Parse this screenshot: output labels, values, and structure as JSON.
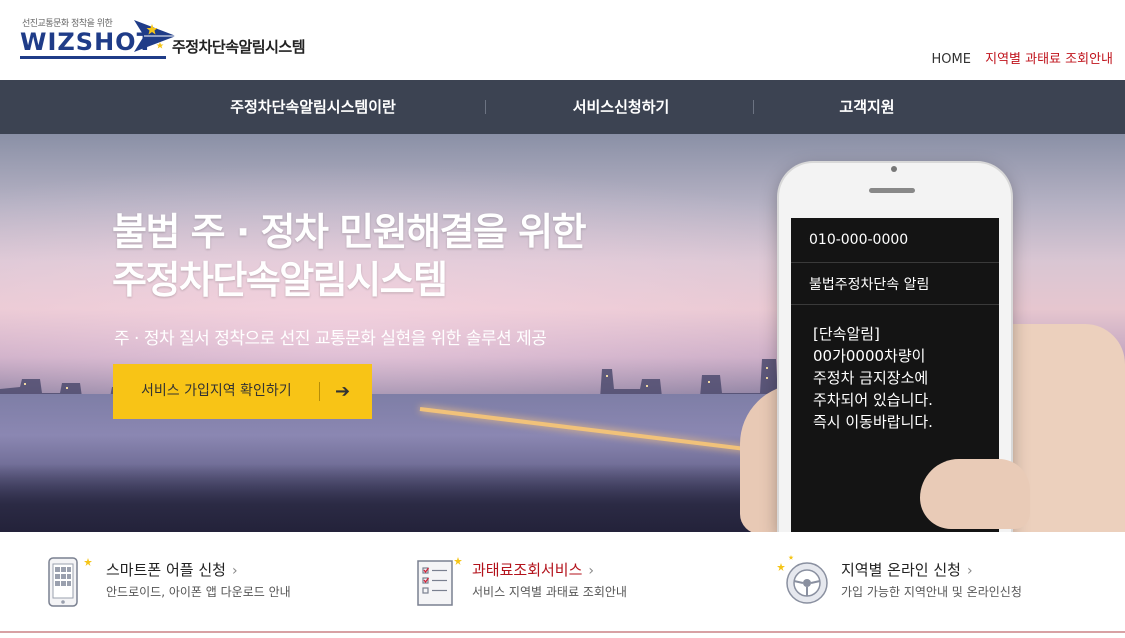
{
  "header": {
    "logo_tagline": "선진교통문화 정착을 위한",
    "logo_word": "WIZSHOT",
    "system_name": "주정차단속알림시스템",
    "util_links": {
      "home": "HOME",
      "fine_lookup": "지역별 과태료 조회안내"
    }
  },
  "nav": {
    "items": [
      {
        "label": "주정차단속알림시스템이란"
      },
      {
        "label": "서비스신청하기"
      },
      {
        "label": "고객지원"
      }
    ]
  },
  "hero": {
    "title_line1": "불법 주 · 정차 민원해결을 위한",
    "title_line2": "주정차단속알림시스템",
    "subtitle": "주 · 정차 질서 정착으로 선진 교통문화 실현을 위한 솔루션 제공",
    "cta_label": "서비스 가입지역 확인하기",
    "cta_arrow": "➔"
  },
  "phone": {
    "number": "010-000-0000",
    "title": "불법주정차단속 알림",
    "body": "[단속알림]\n00가0000차량이\n주정차 금지장소에\n주차되어 있습니다.\n즉시 이동바랍니다."
  },
  "services": [
    {
      "title": "스마트폰 어플 신청",
      "desc": "안드로이드, 아이폰 앱 다운로드 안내",
      "icon": "smartphone-icon",
      "highlight": false
    },
    {
      "title": "과태료조회서비스",
      "desc": "서비스 지역별 과태료 조회안내",
      "icon": "document-checklist-icon",
      "highlight": true
    },
    {
      "title": "지역별 온라인 신청",
      "desc": "가입 가능한 지역안내 및 온라인신청",
      "icon": "steering-wheel-icon",
      "highlight": false
    }
  ],
  "chevron": "›",
  "colors": {
    "nav_bg": "#3c4352",
    "cta": "#f8c416",
    "accent_red": "#c0141d",
    "brand_blue": "#1f3c88"
  }
}
